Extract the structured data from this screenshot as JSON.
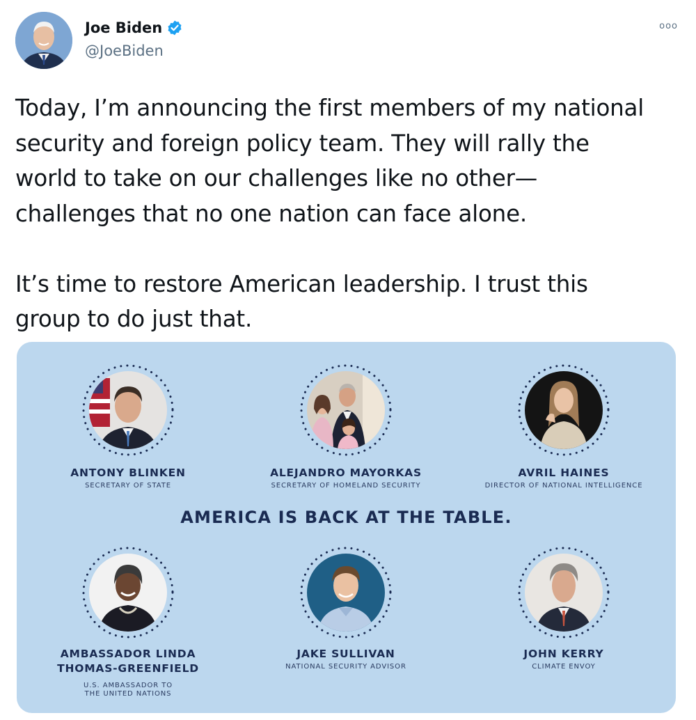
{
  "tweet": {
    "author": {
      "name": "Joe Biden",
      "handle": "@JoeBiden",
      "verified_icon": "verified-badge-icon",
      "accent_color": "#1da1f2"
    },
    "more_menu_label": "ooo",
    "text": "Today, I’m announcing the first members of my national\nsecurity and foreign policy team. They will rally the\nworld to take on our challenges like no other—\nchallenges that no one nation can face alone.\n\nIt’s time to restore American leadership. I trust this\ngroup to do just that."
  },
  "media": {
    "headline": "AMERICA IS BACK AT THE TABLE.",
    "background_color": "#bcd7ee",
    "text_color": "#1a2b52",
    "members": [
      {
        "name": "ANTONY BLINKEN",
        "role": "SECRETARY OF STATE"
      },
      {
        "name": "ALEJANDRO MAYORKAS",
        "role": "SECRETARY OF HOMELAND SECURITY"
      },
      {
        "name": "AVRIL HAINES",
        "role": "DIRECTOR OF NATIONAL INTELLIGENCE"
      },
      {
        "name": "AMBASSADOR LINDA\nTHOMAS-GREENFIELD",
        "role": "U.S. AMBASSADOR TO\nTHE UNITED NATIONS"
      },
      {
        "name": "JAKE SULLIVAN",
        "role": "NATIONAL SECURITY ADVISOR"
      },
      {
        "name": "JOHN KERRY",
        "role": "CLIMATE ENVOY"
      }
    ]
  }
}
